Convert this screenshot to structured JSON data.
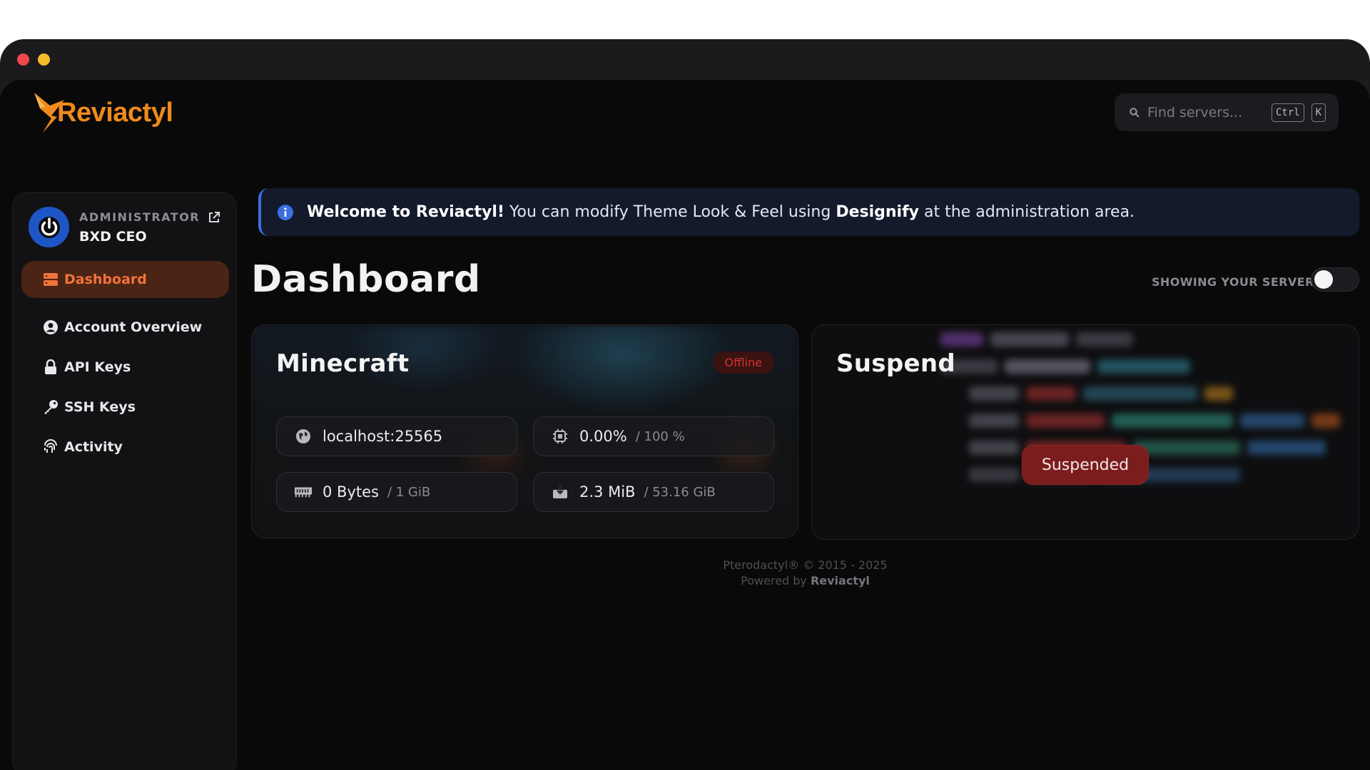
{
  "app": {
    "logo_text": "Reviactyl",
    "brand_color": "#f08a1c",
    "accent_color": "#f2733c"
  },
  "search": {
    "placeholder": "Find servers...",
    "shortcut_ctrl": "Ctrl",
    "shortcut_key": "K"
  },
  "user": {
    "role": "ADMINISTRATOR",
    "name": "BXD CEO"
  },
  "sidebar": {
    "items": [
      {
        "label": "Dashboard",
        "icon": "server-stack-icon",
        "active": true
      },
      {
        "label": "Account Overview",
        "icon": "user-circle-icon",
        "active": false
      },
      {
        "label": "API Keys",
        "icon": "lock-icon",
        "active": false
      },
      {
        "label": "SSH Keys",
        "icon": "key-icon",
        "active": false
      },
      {
        "label": "Activity",
        "icon": "fingerprint-icon",
        "active": false
      }
    ]
  },
  "banner": {
    "strong_start": "Welcome to Reviactyl!",
    "text_middle": " You can modify Theme Look & Feel using ",
    "strong_middle": "Designify",
    "text_end": " at the administration area."
  },
  "page": {
    "title": "Dashboard",
    "toggle_label": "SHOWING YOUR SERVERS"
  },
  "servers": [
    {
      "name": "Minecraft",
      "status": "Offline",
      "address": "localhost:25565",
      "cpu_used": "0.00%",
      "cpu_limit": "/ 100 %",
      "memory_used": "0 Bytes",
      "memory_limit": "/ 1 GiB",
      "disk_used": "2.3 MiB",
      "disk_limit": "/ 53.16 GiB"
    },
    {
      "name": "Suspend",
      "status": "Suspended"
    }
  ],
  "footer": {
    "line1": "Pterodactyl® © 2015 - 2025",
    "line2_prefix": "Powered by ",
    "line2_brand": "Reviactyl"
  }
}
